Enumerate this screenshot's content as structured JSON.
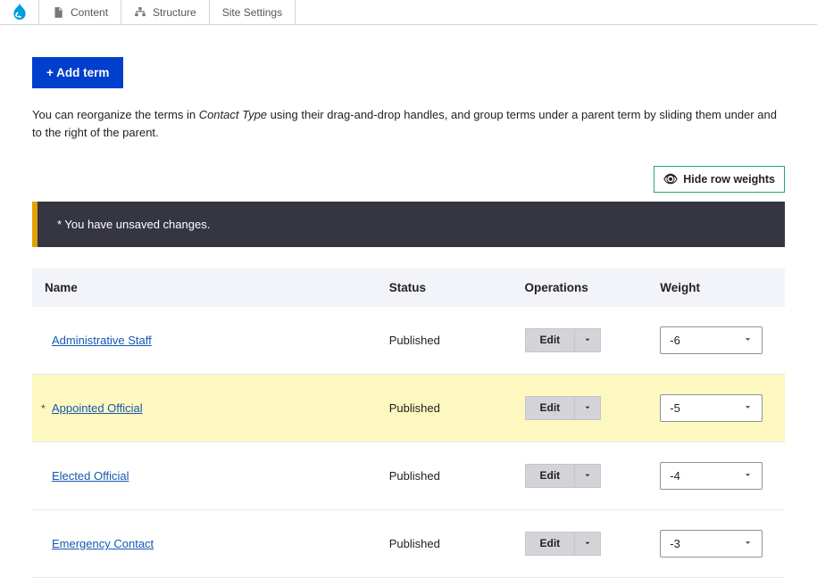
{
  "toolbar": {
    "content": "Content",
    "structure": "Structure",
    "site_settings": "Site Settings"
  },
  "add_term_label": "+ Add term",
  "help_text_pre": "You can reorganize the terms in ",
  "help_text_em": "Contact Type",
  "help_text_post": " using their drag-and-drop handles, and group terms under a parent term by sliding them under and to the right of the parent.",
  "hide_row_weights_label": "Hide row weights",
  "notice_text": "* You have unsaved changes.",
  "table": {
    "headers": {
      "name": "Name",
      "status": "Status",
      "operations": "Operations",
      "weight": "Weight"
    },
    "edit_label": "Edit",
    "rows": [
      {
        "name": "Administrative Staff",
        "status": "Published",
        "weight": "-6",
        "changed": false
      },
      {
        "name": "Appointed Official",
        "status": "Published",
        "weight": "-5",
        "changed": true
      },
      {
        "name": "Elected Official",
        "status": "Published",
        "weight": "-4",
        "changed": false
      },
      {
        "name": "Emergency Contact",
        "status": "Published",
        "weight": "-3",
        "changed": false
      }
    ]
  }
}
